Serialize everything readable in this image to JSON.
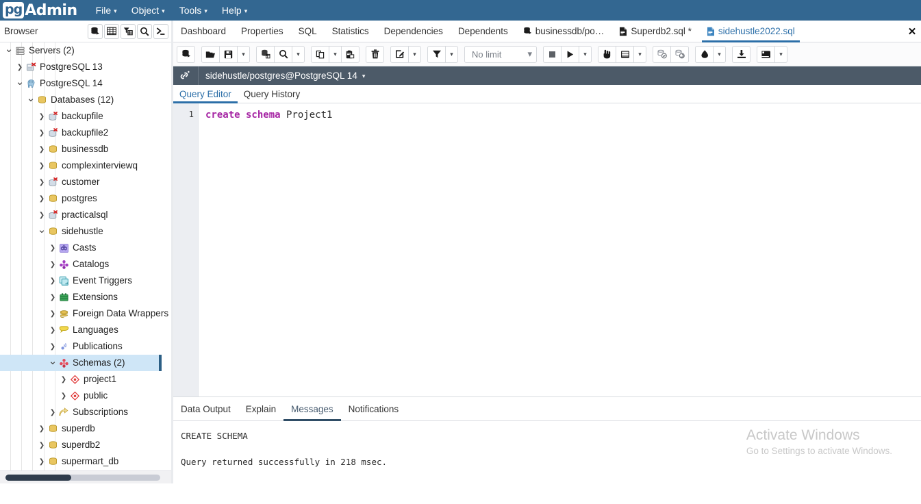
{
  "menubar": {
    "logo_pg": "pg",
    "logo_admin": "Admin",
    "items": [
      {
        "label": "File",
        "icon": "chevron-down-icon"
      },
      {
        "label": "Object",
        "icon": "chevron-down-icon"
      },
      {
        "label": "Tools",
        "icon": "chevron-down-icon"
      },
      {
        "label": "Help",
        "icon": "chevron-down-icon"
      }
    ]
  },
  "browser": {
    "title": "Browser",
    "toolbar_icons": [
      "database-add-icon",
      "table-grid-icon",
      "filter-table-icon",
      "search-icon",
      "terminal-prompt-icon"
    ]
  },
  "tree": [
    {
      "label": "Servers (2)",
      "depth": 0,
      "arrow": "expanded",
      "icon": "servers-icon",
      "selected": false
    },
    {
      "label": "PostgreSQL 13",
      "depth": 1,
      "arrow": "collapsed",
      "icon": "server-disconnected-icon",
      "selected": false
    },
    {
      "label": "PostgreSQL 14",
      "depth": 1,
      "arrow": "expanded",
      "icon": "postgres-elephant-icon",
      "selected": false
    },
    {
      "label": "Databases (12)",
      "depth": 2,
      "arrow": "expanded",
      "icon": "databases-icon",
      "selected": false
    },
    {
      "label": "backupfile",
      "depth": 3,
      "arrow": "collapsed",
      "icon": "database-disconnected-icon",
      "selected": false
    },
    {
      "label": "backupfile2",
      "depth": 3,
      "arrow": "collapsed",
      "icon": "database-disconnected-icon",
      "selected": false
    },
    {
      "label": "businessdb",
      "depth": 3,
      "arrow": "collapsed",
      "icon": "database-icon",
      "selected": false
    },
    {
      "label": "complexinterviewq",
      "depth": 3,
      "arrow": "collapsed",
      "icon": "database-icon",
      "selected": false
    },
    {
      "label": "customer",
      "depth": 3,
      "arrow": "collapsed",
      "icon": "database-disconnected-icon",
      "selected": false
    },
    {
      "label": "postgres",
      "depth": 3,
      "arrow": "collapsed",
      "icon": "database-icon",
      "selected": false
    },
    {
      "label": "practicalsql",
      "depth": 3,
      "arrow": "collapsed",
      "icon": "database-disconnected-icon",
      "selected": false
    },
    {
      "label": "sidehustle",
      "depth": 3,
      "arrow": "expanded",
      "icon": "database-icon",
      "selected": false
    },
    {
      "label": "Casts",
      "depth": 4,
      "arrow": "collapsed",
      "icon": "casts-icon",
      "selected": false
    },
    {
      "label": "Catalogs",
      "depth": 4,
      "arrow": "collapsed",
      "icon": "catalogs-icon",
      "selected": false
    },
    {
      "label": "Event Triggers",
      "depth": 4,
      "arrow": "collapsed",
      "icon": "event-triggers-icon",
      "selected": false
    },
    {
      "label": "Extensions",
      "depth": 4,
      "arrow": "collapsed",
      "icon": "extensions-icon",
      "selected": false
    },
    {
      "label": "Foreign Data Wrappers",
      "depth": 4,
      "arrow": "collapsed",
      "icon": "foreign-data-wrappers-icon",
      "selected": false
    },
    {
      "label": "Languages",
      "depth": 4,
      "arrow": "collapsed",
      "icon": "languages-icon",
      "selected": false
    },
    {
      "label": "Publications",
      "depth": 4,
      "arrow": "collapsed",
      "icon": "publications-icon",
      "selected": false
    },
    {
      "label": "Schemas (2)",
      "depth": 4,
      "arrow": "expanded",
      "icon": "schemas-icon",
      "selected": true
    },
    {
      "label": "project1",
      "depth": 5,
      "arrow": "collapsed",
      "icon": "schema-icon",
      "selected": false
    },
    {
      "label": "public",
      "depth": 5,
      "arrow": "collapsed",
      "icon": "schema-icon",
      "selected": false
    },
    {
      "label": "Subscriptions",
      "depth": 4,
      "arrow": "collapsed",
      "icon": "subscriptions-icon",
      "selected": false
    },
    {
      "label": "superdb",
      "depth": 3,
      "arrow": "collapsed",
      "icon": "database-icon",
      "selected": false
    },
    {
      "label": "superdb2",
      "depth": 3,
      "arrow": "collapsed",
      "icon": "database-icon",
      "selected": false
    },
    {
      "label": "supermart_db",
      "depth": 3,
      "arrow": "collapsed",
      "icon": "database-icon",
      "selected": false
    }
  ],
  "tabs": [
    {
      "label": "Dashboard",
      "icon": null,
      "active": false
    },
    {
      "label": "Properties",
      "icon": null,
      "active": false
    },
    {
      "label": "SQL",
      "icon": null,
      "active": false
    },
    {
      "label": "Statistics",
      "icon": null,
      "active": false
    },
    {
      "label": "Dependencies",
      "icon": null,
      "active": false
    },
    {
      "label": "Dependents",
      "icon": null,
      "active": false
    },
    {
      "label": "businessdb/po…",
      "icon": "database-icon",
      "active": false
    },
    {
      "label": "Superdb2.sql *",
      "icon": "sql-file-icon",
      "active": false
    },
    {
      "label": "sidehustle2022.sql",
      "icon": "sql-file-active-icon",
      "active": true
    }
  ],
  "tab_close_label": "✕",
  "query_toolbar": {
    "groups": [
      {
        "buttons": [
          {
            "icon": "open-new-connection-icon",
            "dropdown": false
          }
        ]
      },
      {
        "buttons": [
          {
            "icon": "open-file-icon",
            "dropdown": false
          },
          {
            "icon": "save-file-icon",
            "dropdown": false
          },
          {
            "icon": "chevron-down-icon",
            "dropdown": true
          }
        ]
      },
      {
        "buttons": [
          {
            "icon": "edit-data-icon",
            "dropdown": false
          },
          {
            "icon": "search-icon",
            "dropdown": false
          },
          {
            "icon": "chevron-down-icon",
            "dropdown": true
          }
        ]
      },
      {
        "buttons": [
          {
            "icon": "copy-icon",
            "dropdown": false
          },
          {
            "icon": "chevron-down-icon",
            "dropdown": true
          },
          {
            "icon": "paste-icon",
            "dropdown": false
          }
        ]
      },
      {
        "buttons": [
          {
            "icon": "delete-trash-icon",
            "dropdown": false
          }
        ]
      },
      {
        "buttons": [
          {
            "icon": "edit-pencil-icon",
            "dropdown": false
          },
          {
            "icon": "chevron-down-icon",
            "dropdown": true
          }
        ]
      },
      {
        "buttons": [
          {
            "icon": "filter-icon",
            "dropdown": false
          },
          {
            "icon": "chevron-down-icon",
            "dropdown": true
          }
        ]
      }
    ],
    "limit": {
      "value": "No limit",
      "icon": "chevron-down-icon"
    },
    "groups2": [
      {
        "buttons": [
          {
            "icon": "stop-square-icon",
            "dropdown": false
          },
          {
            "icon": "execute-play-icon",
            "dropdown": false
          },
          {
            "icon": "chevron-down-icon",
            "dropdown": true
          }
        ]
      },
      {
        "buttons": [
          {
            "icon": "explain-hand-icon",
            "dropdown": false
          },
          {
            "icon": "explain-analyze-icon",
            "dropdown": false
          },
          {
            "icon": "chevron-down-icon",
            "dropdown": true
          }
        ]
      },
      {
        "buttons": [
          {
            "icon": "commit-icon",
            "dropdown": false
          },
          {
            "icon": "rollback-icon",
            "dropdown": false
          }
        ]
      },
      {
        "buttons": [
          {
            "icon": "clear-icon",
            "dropdown": false
          },
          {
            "icon": "chevron-down-icon",
            "dropdown": true
          }
        ]
      },
      {
        "buttons": [
          {
            "icon": "download-csv-icon",
            "dropdown": false
          }
        ]
      },
      {
        "buttons": [
          {
            "icon": "macros-icon",
            "dropdown": false
          },
          {
            "icon": "chevron-down-icon",
            "dropdown": true
          }
        ]
      }
    ]
  },
  "connection": {
    "icon": "connection-link-icon",
    "text": "sidehustle/postgres@PostgreSQL 14",
    "caret": "chevron-down-icon"
  },
  "editor_tabs": [
    {
      "label": "Query Editor",
      "active": true
    },
    {
      "label": "Query History",
      "active": false
    }
  ],
  "editor": {
    "line_number": "1",
    "keyword": "create schema",
    "identifier": " Project1"
  },
  "output_tabs": [
    {
      "label": "Data Output",
      "active": false
    },
    {
      "label": "Explain",
      "active": false
    },
    {
      "label": "Messages",
      "active": true
    },
    {
      "label": "Notifications",
      "active": false
    }
  ],
  "messages": "CREATE SCHEMA\n\nQuery returned successfully in 218 msec.",
  "watermark": {
    "line1": "Activate Windows",
    "line2": "Go to Settings to activate Windows."
  },
  "colors": {
    "brand": "#336791",
    "accent": "#2c6fa8",
    "connbar": "#4c5a68",
    "selection": "#cfe6f7",
    "keyword": "#a626a4"
  }
}
